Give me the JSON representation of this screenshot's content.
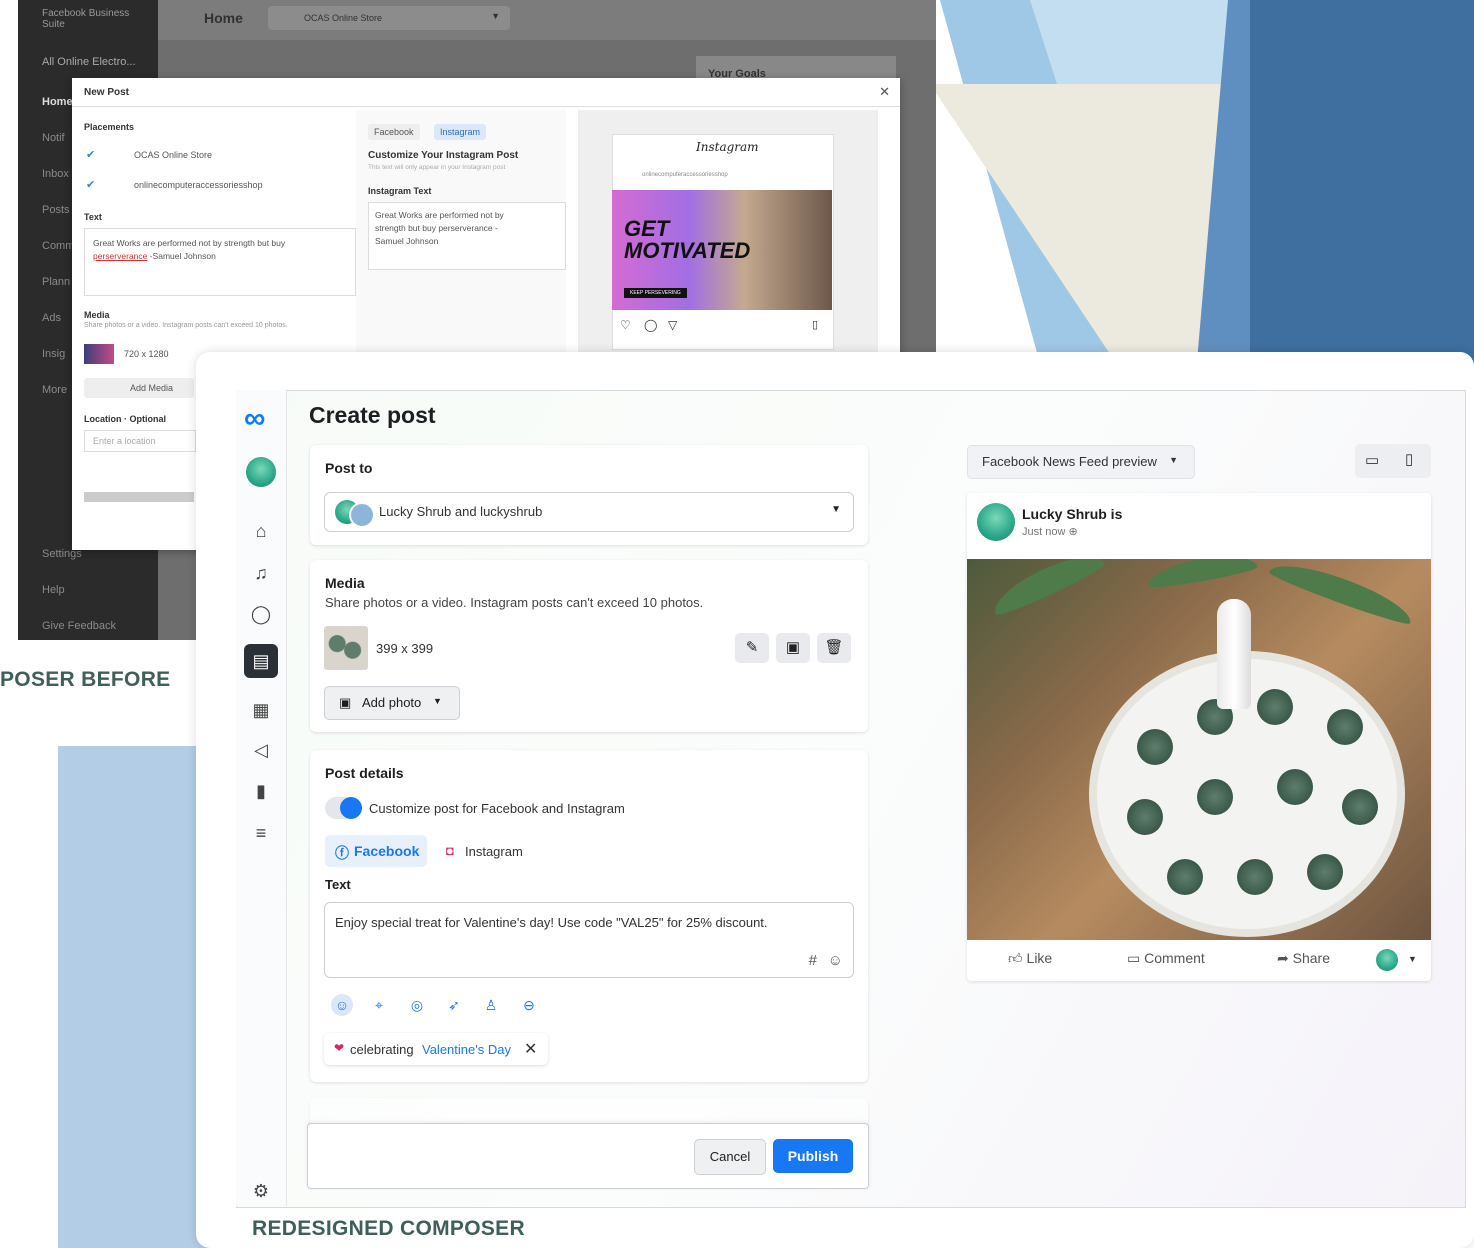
{
  "old_composer": {
    "brand": "Facebook Business Suite",
    "account": "All Online Electro...",
    "sidebar_items": [
      "Home",
      "Notif",
      "Inbox",
      "Posts",
      "Comm",
      "Plann",
      "Ads",
      "Insig",
      "More",
      "Settings",
      "Help",
      "Give Feedback"
    ],
    "header_title": "Home",
    "store_select": "OCAS Online Store",
    "goals": "Your Goals",
    "modal": {
      "title": "New Post",
      "placements_label": "Placements",
      "placement_1": "OCAS Online Store",
      "placement_2": "onlinecomputeraccessoriesshop",
      "text_label": "Text",
      "text_value": "Great Works are performed not by strength but buy",
      "text_value_2": "perserverance",
      "text_value_3": "-Samuel Johnson",
      "media_label": "Media",
      "media_hint": "Share photos or a video. Instagram posts can't exceed 10 photos.",
      "media_size": "720 x 1280",
      "add_media": "Add Media",
      "location_label": "Location · Optional",
      "location_placeholder": "Enter a location",
      "tab_facebook": "Facebook",
      "tab_instagram": "Instagram",
      "customize_title": "Customize Your Instagram Post",
      "customize_hint": "This text will only appear in your Instagram post",
      "ig_text_label": "Instagram Text",
      "ig_text_value": "Great Works are performed not by strength but buy perserverance - Samuel Johnson",
      "ig_brand": "Instagram",
      "ig_handle": "onlinecomputeraccessoriesshop",
      "ig_banner_1": "GET",
      "ig_banner_2": "MOTIVATED",
      "ig_banner_small": "KEEP PERSEVERING"
    }
  },
  "caption_before": "POSER BEFORE",
  "caption_after": "REDESIGNED COMPOSER",
  "composer": {
    "title": "Create post",
    "post_to_label": "Post to",
    "post_to_value": "Lucky Shrub and luckyshrub",
    "media_label": "Media",
    "media_hint": "Share photos or a video. Instagram posts can't exceed 10 photos.",
    "media_size": "399 x 399",
    "add_photo": "Add photo",
    "details_label": "Post details",
    "customize_toggle": "Customize post for Facebook and Instagram",
    "tab_facebook": "Facebook",
    "tab_instagram": "Instagram",
    "text_label": "Text",
    "text_value": "Enjoy special treat for Valentine's day! Use code \"VAL25\" for 25% discount.",
    "hashtag": "#",
    "feeling_prefix": "celebrating",
    "feeling_value": "Valentine's Day",
    "cancel": "Cancel",
    "publish": "Publish"
  },
  "preview": {
    "select": "Facebook News Feed preview",
    "page_name": "Lucky Shrub is",
    "time": "Just now",
    "like": "Like",
    "comment": "Comment",
    "share": "Share"
  },
  "colors": {
    "accent": "#1877f2",
    "caption": "#3e5f5a",
    "rail_active": "#2b2f36"
  }
}
